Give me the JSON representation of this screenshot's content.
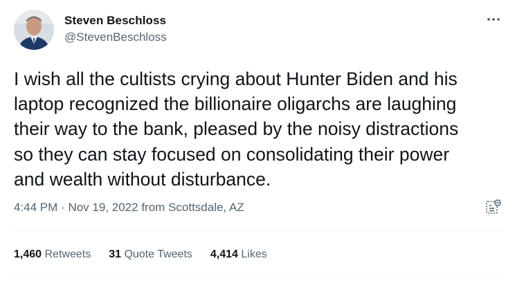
{
  "author": {
    "name": "Steven Beschloss",
    "handle": "@StevenBeschloss"
  },
  "tweet": {
    "text": "I wish all the cultists crying about Hunter Biden and his\nlaptop recognized the billionaire oligarchs are laughing\ntheir way to the bank, pleased by the noisy distractions\nso they can stay  focused on consolidating their power\nand wealth without disturbance."
  },
  "meta": {
    "time": "4:44 PM",
    "separator": "·",
    "date": "Nov 19, 2022",
    "source": "from Scottsdale, AZ"
  },
  "stats": {
    "retweets_count": "1,460",
    "retweets_label": "Retweets",
    "quotes_count": "31",
    "quotes_label": "Quote Tweets",
    "likes_count": "4,414",
    "likes_label": "Likes"
  },
  "icons": {
    "more": "more-options-icon",
    "source": "tweet-source-icon"
  },
  "colors": {
    "text": "#0f1419",
    "secondary": "#536471",
    "divider": "#eff3f4"
  }
}
